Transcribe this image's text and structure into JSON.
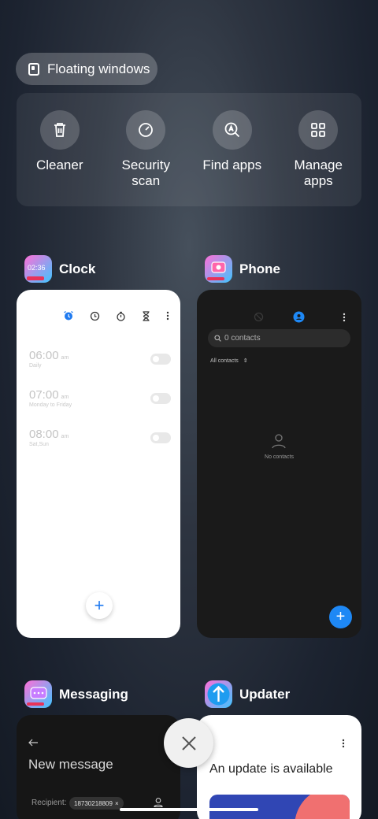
{
  "floating_windows": {
    "label": "Floating windows"
  },
  "tools": [
    {
      "label": "Cleaner",
      "icon": "trash-icon"
    },
    {
      "label": "Security\nscan",
      "icon": "shield-scan-icon"
    },
    {
      "label": "Find apps",
      "icon": "find-apps-icon"
    },
    {
      "label": "Manage\napps",
      "icon": "grid-icon"
    }
  ],
  "apps": {
    "clock": {
      "name": "Clock",
      "icon_text": "02:36",
      "alarms": [
        {
          "time": "06:00",
          "ampm": "am",
          "repeat": "Daily"
        },
        {
          "time": "07:00",
          "ampm": "am",
          "repeat": "Monday to Friday"
        },
        {
          "time": "08:00",
          "ampm": "am",
          "repeat": "Sat,Sun"
        }
      ],
      "add_label": "+"
    },
    "phone": {
      "name": "Phone",
      "search_placeholder": "0 contacts",
      "filter_label": "All contacts",
      "empty_label": "No contacts",
      "add_label": "+"
    },
    "messaging": {
      "name": "Messaging",
      "title": "New message",
      "recipient_label": "Recipient:",
      "recipient_value": "18730218809"
    },
    "updater": {
      "name": "Updater",
      "title": "An update is available"
    }
  },
  "colors": {
    "accent_blue": "#1e88f5",
    "clock_accent": "#1f7af0"
  }
}
